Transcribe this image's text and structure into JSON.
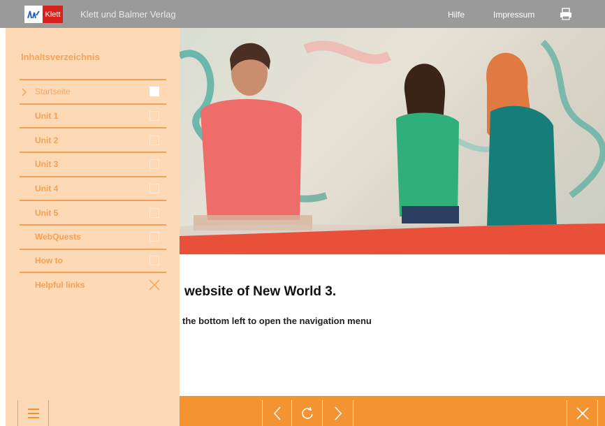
{
  "topbar": {
    "logo_text": "Klett",
    "publisher": "Klett und Balmer Verlag",
    "help_link": "Hilfe",
    "imprint_link": "Impressum",
    "print_icon": "printer-icon"
  },
  "sidebar": {
    "title": "Inhaltsverzeichnis",
    "items": [
      {
        "label": "Startseite",
        "checked": true
      },
      {
        "label": "Unit 1",
        "checked": false
      },
      {
        "label": "Unit 2",
        "checked": false
      },
      {
        "label": "Unit 3",
        "checked": false
      },
      {
        "label": "Unit 4",
        "checked": false
      },
      {
        "label": "Unit 5",
        "checked": false
      },
      {
        "label": "WebQuests",
        "checked": false
      },
      {
        "label": "How to",
        "checked": false
      },
      {
        "label": "Helpful links",
        "icon": "close-icon"
      }
    ]
  },
  "main": {
    "headline": "website of New World 3.",
    "subline": "the bottom left to open the navigation menu"
  },
  "bottombar": {
    "menu_icon": "hamburger-menu-icon",
    "prev_icon": "chevron-left-icon",
    "reload_icon": "reload-icon",
    "next_icon": "chevron-right-icon",
    "close_icon": "close-icon"
  },
  "colors": {
    "topbar": "#9a9a9a",
    "sidebar": "#fdd9b5",
    "accent": "#f39332",
    "band": "#e8503a",
    "logo_red": "#d9221b"
  }
}
